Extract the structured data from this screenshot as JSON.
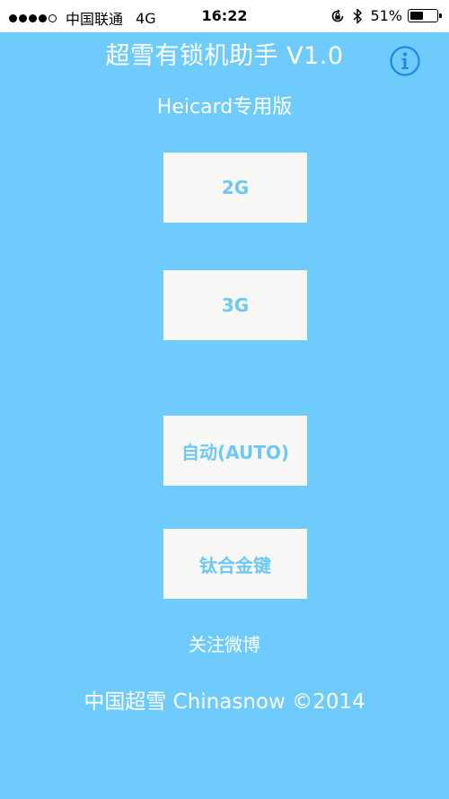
{
  "status_bar": {
    "carrier": "中国联通",
    "network": "4G",
    "time": "16:22",
    "battery_percent_label": "51%",
    "battery_level": 0.51
  },
  "header": {
    "title": "超雪有锁机助手 V1.0",
    "info_icon": "info-circle-icon",
    "subtitle": "Heicard专用版"
  },
  "buttons": {
    "b2g": "2G",
    "b3g": "3G",
    "auto": "自动(AUTO)",
    "titanium": "钛合金键"
  },
  "links": {
    "follow_weibo": "关注微博"
  },
  "footer": {
    "copyright": "中国超雪 Chinasnow ©2014"
  },
  "colors": {
    "background": "#6fcbfb",
    "button_bg": "#f7f8f6",
    "button_text": "#6fc7f3",
    "info_icon": "#1e88e5"
  }
}
